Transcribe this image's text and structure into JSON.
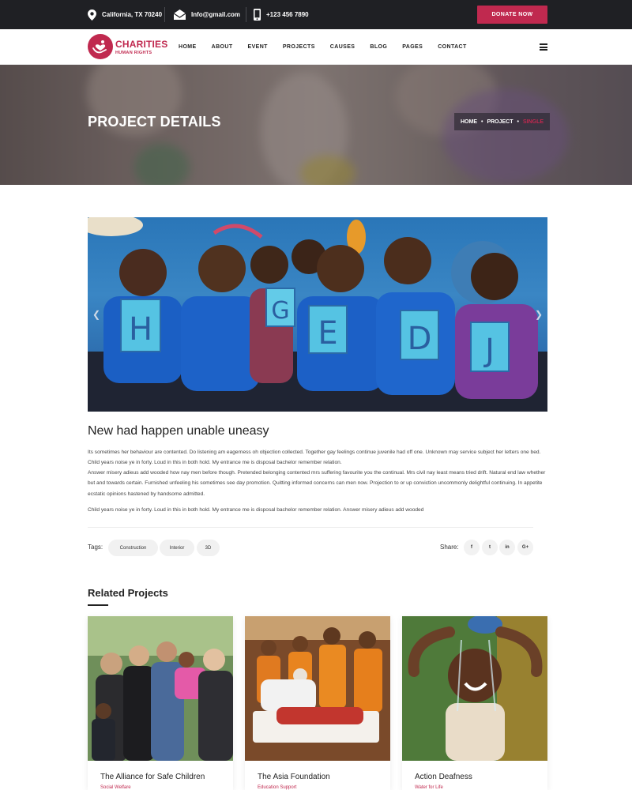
{
  "topbar": {
    "location": "California, TX 70240",
    "email": "Info@gmail.com",
    "phone": "+123 456 7890",
    "donate_label": "DONATE NOW",
    "location_icon": "map-pin-icon",
    "email_icon": "envelope-icon",
    "phone_icon": "phone-icon"
  },
  "brand": {
    "name": "CHARITIES",
    "tagline": "HUMAN RIGHTS",
    "logo_icon": "heart-hands-icon"
  },
  "nav": {
    "items": [
      "HOME",
      "ABOUT",
      "EVENT",
      "PROJECTS",
      "CAUSES",
      "BLOG",
      "PAGES",
      "CONTACT"
    ],
    "menu_icon": "hamburger-icon"
  },
  "banner": {
    "title": "PROJECT DETAILS",
    "breadcrumb": [
      "HOME",
      "PROJECT",
      "SINGLE"
    ]
  },
  "hero": {
    "letters": [
      "H",
      "G",
      "E",
      "D",
      "J"
    ],
    "prev_icon": "chevron-left-icon",
    "next_icon": "chevron-right-icon"
  },
  "post": {
    "title": "New had happen unable uneasy",
    "para1": "Its sometimes her behaviour are contented. Do listening am eagerness oh objection collected. Together gay feelings continue juvenile had off one. Unknown may service subject her letters one bed. Child years noise ye in forty. Loud in this in both hold. My entrance me is disposal bachelor remember relation.",
    "para2": "Answer misery adieus add wooded how nay men before though. Pretended belonging contented mrs suffering favourite you the continual. Mrs civil nay least means tried drift. Natural end law whether but and towards certain. Furnished unfeeling his sometimes see day promotion. Quitting informed concerns can men now. Projection to or up conviction uncommonly delightful continuing. In appetite ecstatic opinions hastened by handsome admitted.",
    "para3": "Child years noise ye in forty. Loud in this in both hold. My entrance me is disposal bachelor remember relation. Answer misery adieus add wooded"
  },
  "tags": {
    "label": "Tags:",
    "items": [
      "Construction",
      "Interior",
      "3D"
    ]
  },
  "share": {
    "label": "Share:",
    "items": [
      {
        "icon": "facebook-icon",
        "glyph": "f"
      },
      {
        "icon": "twitter-icon",
        "glyph": "t"
      },
      {
        "icon": "linkedin-icon",
        "glyph": "in"
      },
      {
        "icon": "google-plus-icon",
        "glyph": "G+"
      }
    ]
  },
  "related": {
    "heading": "Related Projects",
    "cards": [
      {
        "title": "The Alliance for Safe Children",
        "category": "Social Welfare"
      },
      {
        "title": "The Asia Foundation",
        "category": "Education Support"
      },
      {
        "title": "Action Deafness",
        "category": "Water for Life"
      }
    ]
  },
  "colors": {
    "accent": "#c0294f",
    "topbar_bg": "#1f2024"
  }
}
